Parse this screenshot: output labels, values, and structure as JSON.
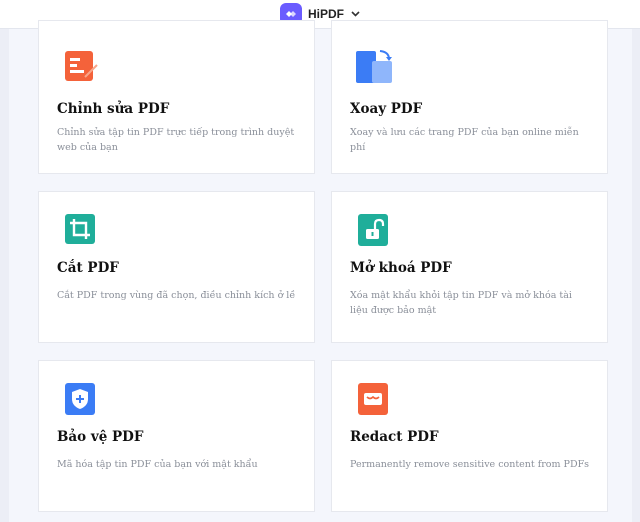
{
  "header": {
    "brand": "HiPDF",
    "logo_icon": "hipdf-logo-icon",
    "dropdown_icon": "chevron-down-icon"
  },
  "colors": {
    "brand": "#6b5cff",
    "edit": "#f4623a",
    "rotate": "#3b7cf5",
    "crop": "#1fae9a",
    "unlock": "#1fae9a",
    "protect": "#3b7cf5",
    "redact": "#f4623a"
  },
  "tools": [
    {
      "title": "Chỉnh sửa PDF",
      "desc": "Chỉnh sửa tập tin PDF trực tiếp trong trình duyệt web của bạn",
      "icon": "edit-pdf-icon"
    },
    {
      "title": "Xoay PDF",
      "desc": "Xoay và lưu các trang PDF của bạn online miễn phí",
      "icon": "rotate-pdf-icon"
    },
    {
      "title": "Cắt PDF",
      "desc": "Cắt PDF trong vùng đã chọn, điều chỉnh kích ở lề",
      "icon": "crop-pdf-icon"
    },
    {
      "title": "Mở khoá PDF",
      "desc": "Xóa mật khẩu khỏi tập tin PDF và mở khóa tài liệu được bảo mật",
      "icon": "unlock-pdf-icon"
    },
    {
      "title": "Bảo vệ PDF",
      "desc": "Mã hóa tập tin PDF của bạn với mật khẩu",
      "icon": "protect-pdf-icon"
    },
    {
      "title": "Redact PDF",
      "desc": "Permanently remove sensitive content from PDFs",
      "icon": "redact-pdf-icon"
    }
  ]
}
